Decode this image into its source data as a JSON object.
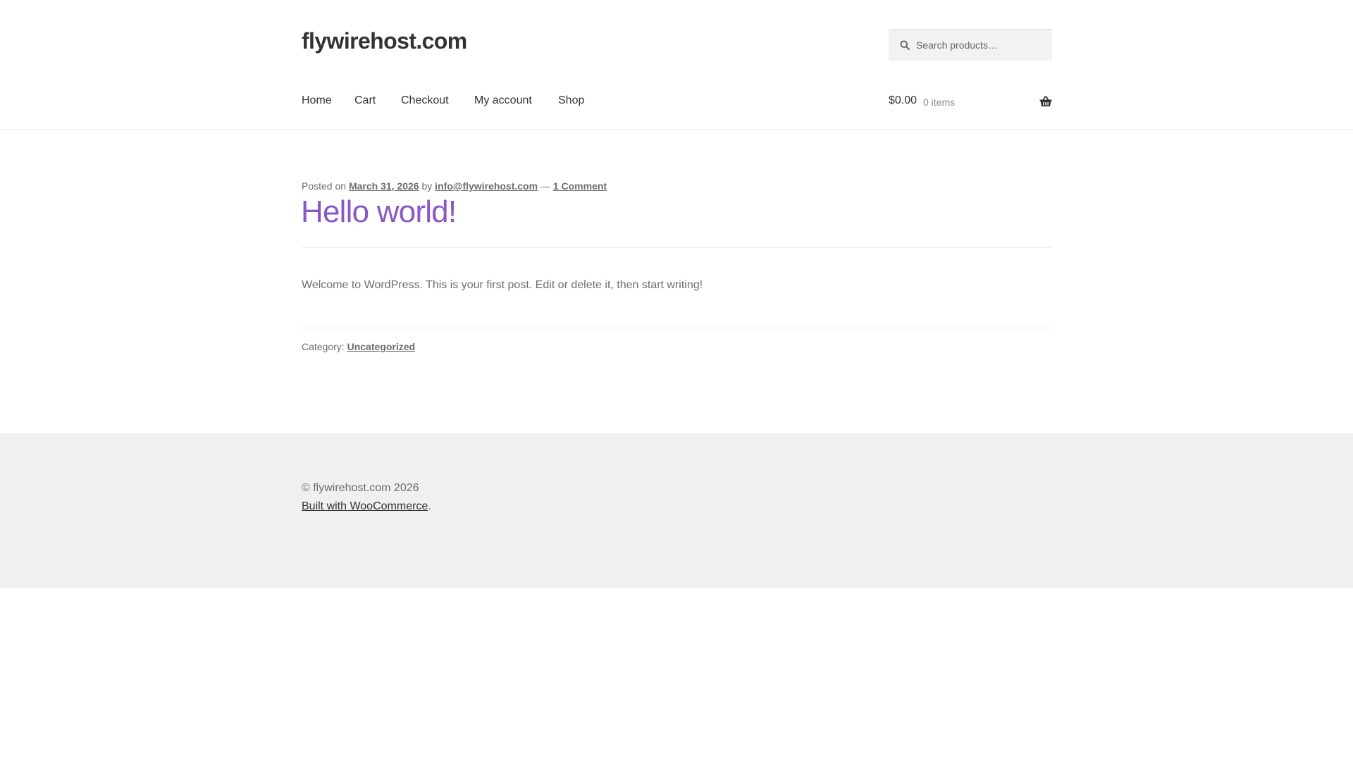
{
  "header": {
    "site_title": "flywirehost.com",
    "search": {
      "placeholder": "Search products…",
      "icon": "search-icon"
    },
    "nav": [
      "Home",
      "Cart",
      "Checkout",
      "My account",
      "Shop"
    ],
    "cart": {
      "amount": "$0.00",
      "count": "0 items",
      "icon": "basket-icon"
    }
  },
  "post": {
    "posted_on_prefix": "Posted on",
    "date": "March 31, 2026",
    "by_text": "by",
    "author": "info@flywirehost.com",
    "dash": "—",
    "comments": "1 Comment",
    "title": "Hello world!",
    "content": "Welcome to WordPress. This is your first post. Edit or delete it, then start writing!",
    "category_label": "Category:",
    "category": "Uncategorized"
  },
  "footer": {
    "copyright": "© flywirehost.com 2026",
    "built_with": "Built with WooCommerce",
    "built_with_suffix": "."
  },
  "colors": {
    "accent_title": "#8959c3",
    "text": "#6d6d6d",
    "heading": "#333333",
    "footer_bg": "#f0f0f0"
  }
}
